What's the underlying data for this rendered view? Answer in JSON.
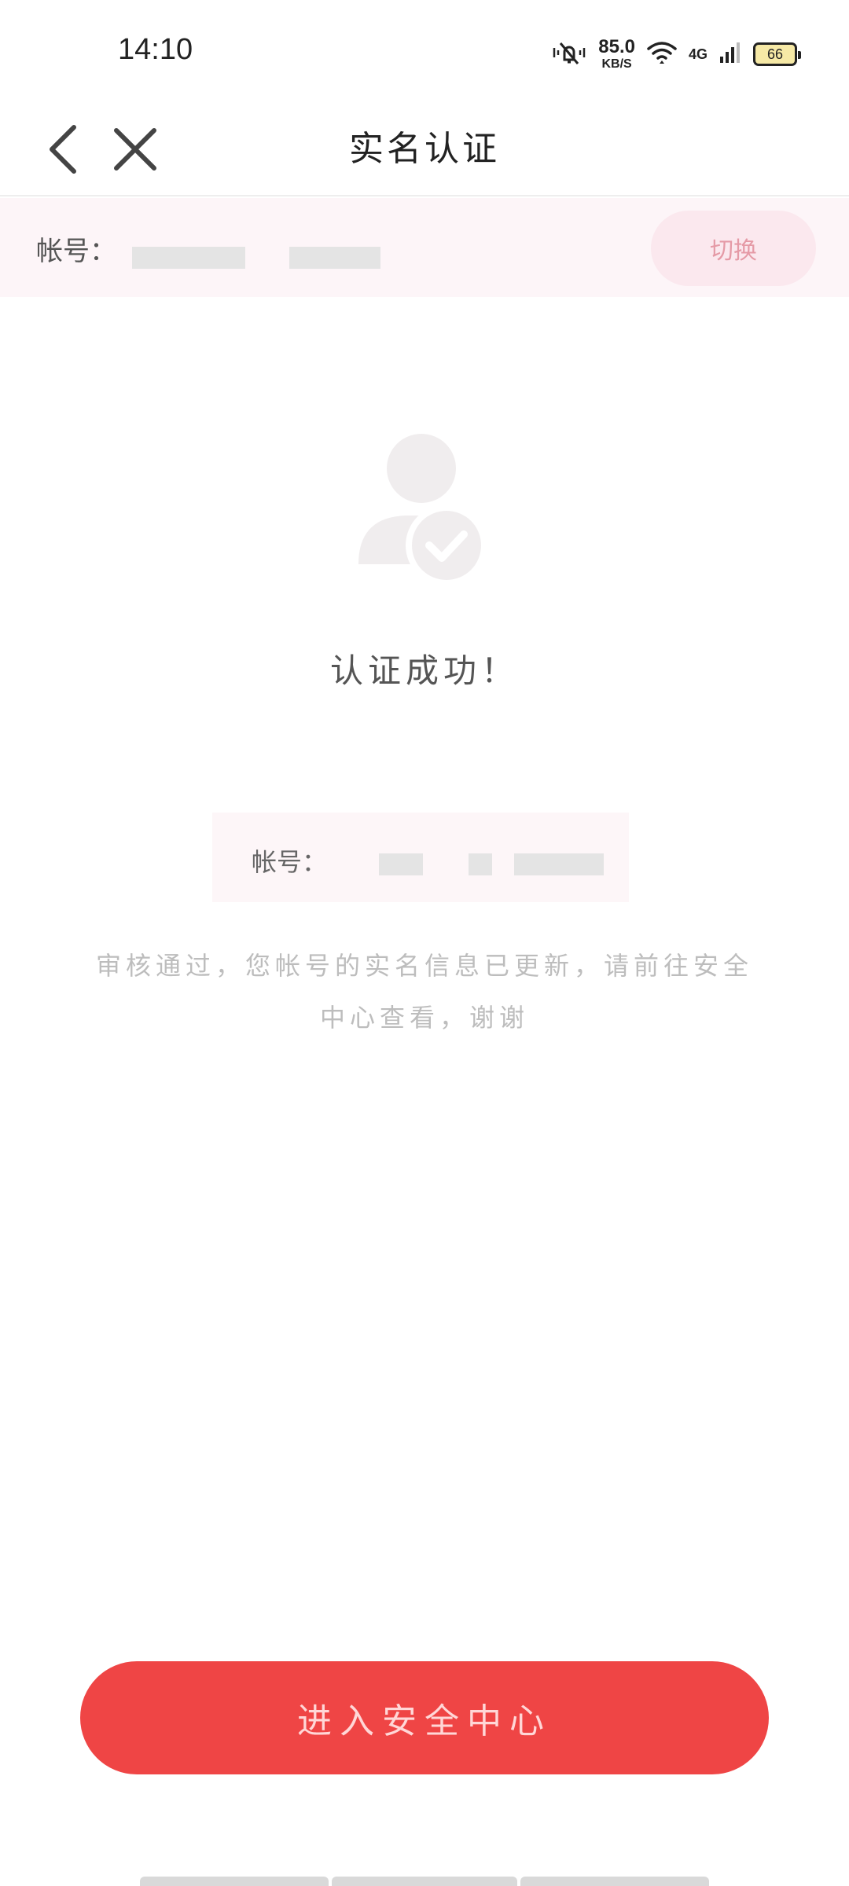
{
  "status_bar": {
    "time": "14:10",
    "speed_value": "85.0",
    "speed_unit": "KB/S",
    "network": "4G",
    "battery": "66",
    "icons": [
      "mute-vibrate-icon",
      "wifi-icon",
      "cellular-signal-icon",
      "battery-icon"
    ]
  },
  "nav": {
    "title": "实名认证",
    "back_icon": "chevron-left-icon",
    "close_icon": "close-icon"
  },
  "account_bar": {
    "label": "帐号：",
    "switch_label": "切换"
  },
  "result": {
    "icon": "user-verified-icon",
    "title": "认证成功！",
    "account_label": "帐号：",
    "description": "审核通过，您帐号的实名信息已更新，请前往安全中心查看，谢谢"
  },
  "actions": {
    "enter_security_center": "进入安全中心"
  },
  "colors": {
    "accent": "#ef4545",
    "account_bar_bg": "#fdf5f8",
    "switch_bg": "#fbe8ee",
    "switch_text": "#e59aa6",
    "muted_text": "#bdbdbd"
  }
}
